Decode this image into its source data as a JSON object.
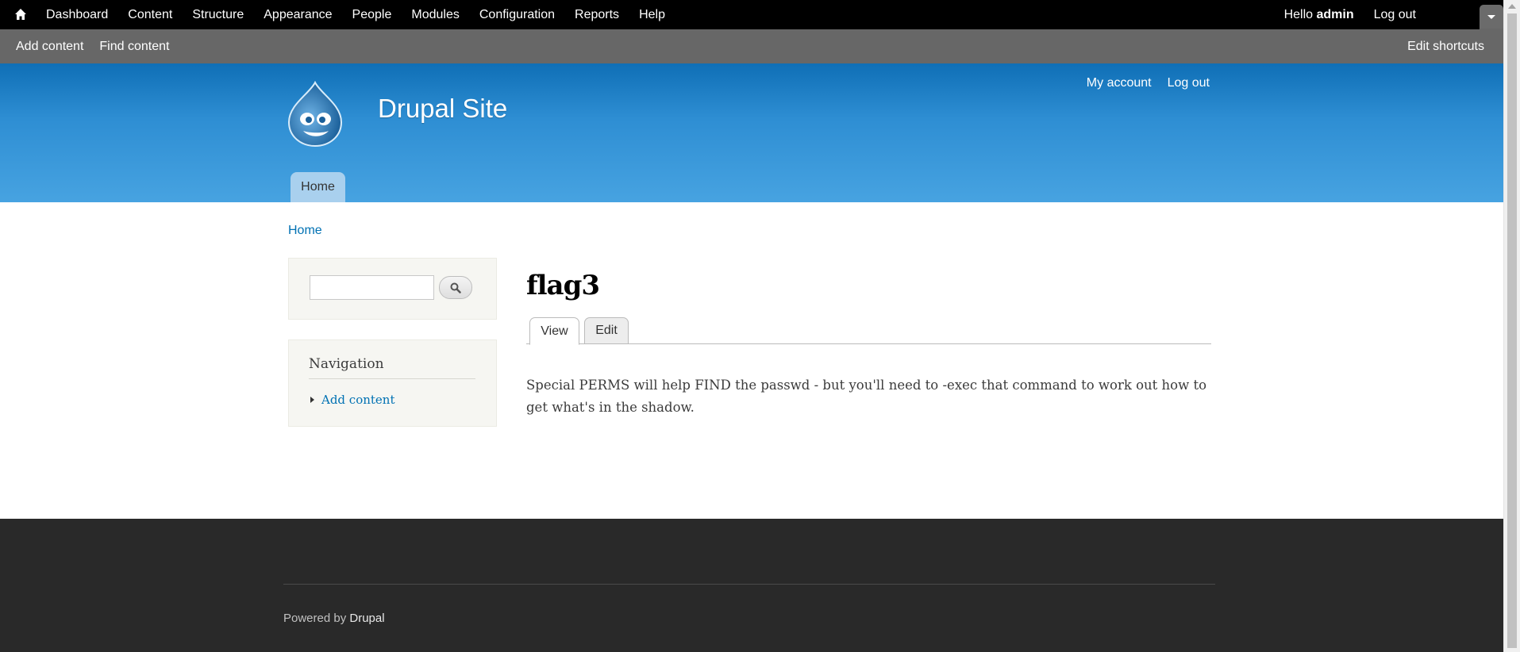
{
  "toolbar": {
    "menu": [
      "Dashboard",
      "Content",
      "Structure",
      "Appearance",
      "People",
      "Modules",
      "Configuration",
      "Reports",
      "Help"
    ],
    "hello_prefix": "Hello ",
    "username": "admin",
    "logout": "Log out",
    "icons": {
      "home": "home-icon",
      "drawer": "chevron-down-icon"
    }
  },
  "shortcuts": {
    "items": [
      "Add content",
      "Find content"
    ],
    "edit": "Edit shortcuts"
  },
  "header": {
    "site_name": "Drupal Site",
    "secondary_menu": [
      "My account",
      "Log out"
    ],
    "main_menu": [
      "Home"
    ],
    "gradient": [
      "#0f6fb6",
      "#47a3e1"
    ]
  },
  "breadcrumb": "Home",
  "sidebar": {
    "search": {
      "value": "",
      "placeholder": ""
    },
    "navigation": {
      "title": "Navigation",
      "items": [
        "Add content"
      ]
    }
  },
  "main": {
    "title": "flag3",
    "tabs": [
      "View",
      "Edit"
    ],
    "active_tab": "View",
    "body": "Special PERMS will help FIND the passwd - but you'll need to -exec that command to work out how to get what's in the shadow."
  },
  "footer": {
    "powered_by": "Powered by",
    "link": "Drupal"
  },
  "colors": {
    "link": "#0071b3",
    "toolbar_bg": "#000000",
    "shortcut_bg": "#676767",
    "footer_bg": "#292929"
  }
}
